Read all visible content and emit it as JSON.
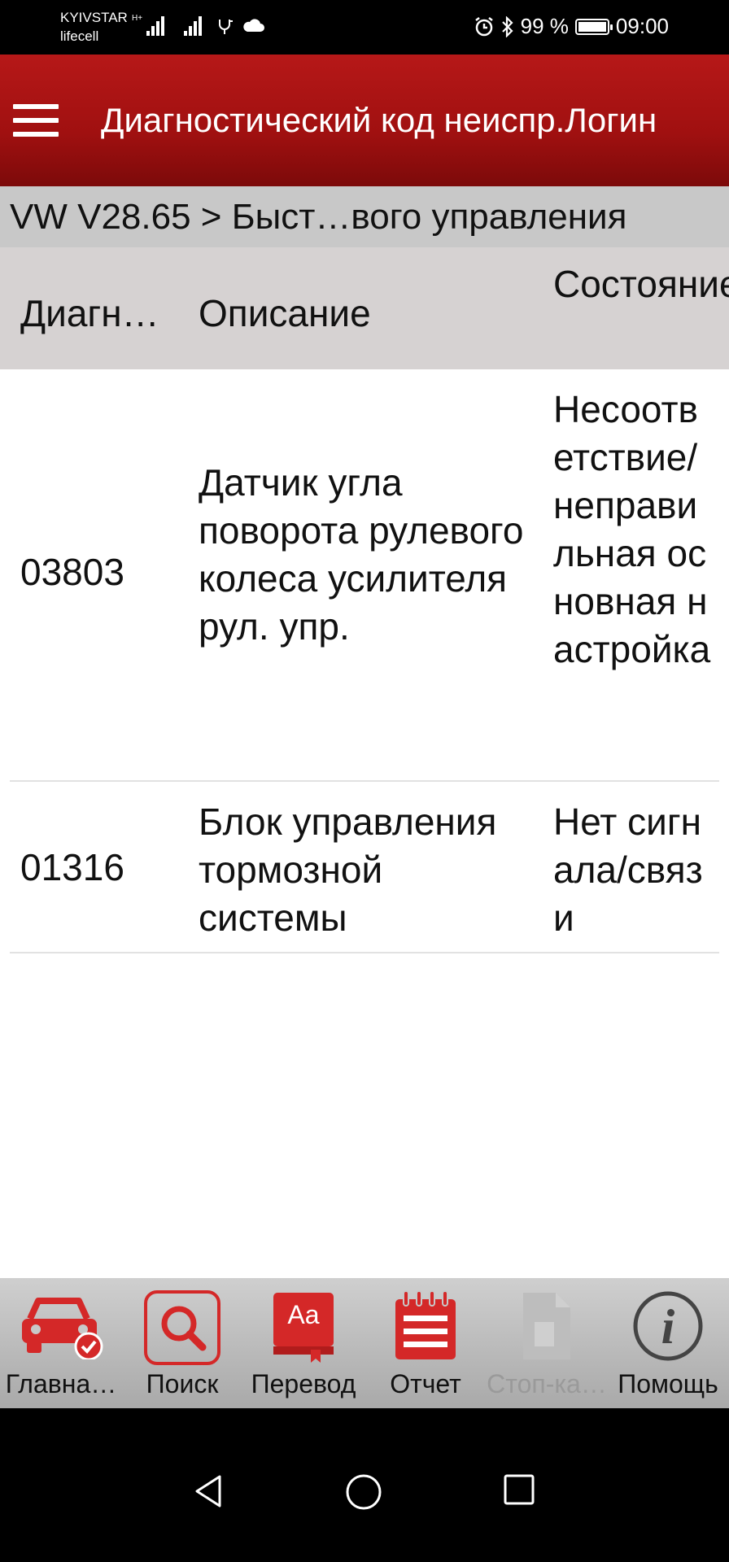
{
  "status_bar": {
    "carrier1": "KYIVSTAR",
    "carrier2": "lifecell",
    "network_type": "H+",
    "battery": "99 %",
    "time": "09:00"
  },
  "app_bar": {
    "title": "Диагностический код неиспр.Логин"
  },
  "breadcrumb": "VW V28.65 > Быст…вого управления",
  "table": {
    "headers": {
      "code": "Диагн…",
      "description": "Описание",
      "status": "Состояние"
    },
    "rows": [
      {
        "code": "03803",
        "description": "Датчик угла поворота рулевого колеса усилителя рул. упр.",
        "status": "Несоответствие/неправильная основная настройка"
      },
      {
        "code": "01316",
        "description": "Блок управления тормозной системы",
        "status": "Нет сигнала/связи"
      }
    ]
  },
  "toolbar": {
    "items": [
      {
        "label": "Главна…",
        "icon": "car-check-icon",
        "enabled": true
      },
      {
        "label": "Поиск",
        "icon": "search-icon",
        "enabled": true
      },
      {
        "label": "Перевод",
        "icon": "translate-book-icon",
        "enabled": true
      },
      {
        "label": "Отчет",
        "icon": "report-notepad-icon",
        "enabled": true
      },
      {
        "label": "Стоп-ка…",
        "icon": "freeze-frame-document-icon",
        "enabled": false
      },
      {
        "label": "Помощь",
        "icon": "info-help-icon",
        "enabled": true
      }
    ]
  },
  "colors": {
    "accent": "#c21e1e",
    "app_bar": "#a01010",
    "header_bg": "#d6d2d2",
    "breadcrumb_bg": "#c8c8c8"
  }
}
